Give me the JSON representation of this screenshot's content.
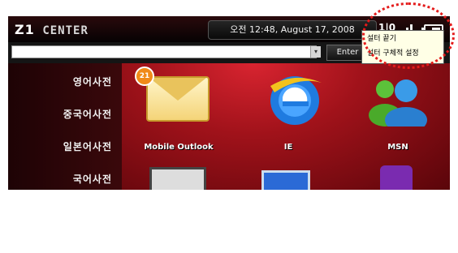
{
  "header": {
    "logo_main": "Z1",
    "logo_sub": "CENTER",
    "datetime": "오전 12:48, August 17, 2008",
    "network_label": "1|0"
  },
  "address_bar": {
    "value": "",
    "enter_label": "Enter"
  },
  "sidebar": {
    "items": [
      {
        "label": "영어사전"
      },
      {
        "label": "중국어사전"
      },
      {
        "label": "일본어사전"
      },
      {
        "label": "국어사전"
      }
    ]
  },
  "tiles": [
    {
      "label": "Mobile Outlook",
      "icon": "envelope-icon",
      "badge": "21"
    },
    {
      "label": "IE",
      "icon": "internet-explorer-icon"
    },
    {
      "label": "MSN",
      "icon": "msn-messenger-icon"
    }
  ],
  "popup_menu": {
    "items": [
      {
        "label": "설터 끝기"
      },
      {
        "label": "설터 구체적 설정"
      }
    ]
  },
  "colors": {
    "accent_red": "#a0121a",
    "highlight_ring": "#e41b1b"
  }
}
